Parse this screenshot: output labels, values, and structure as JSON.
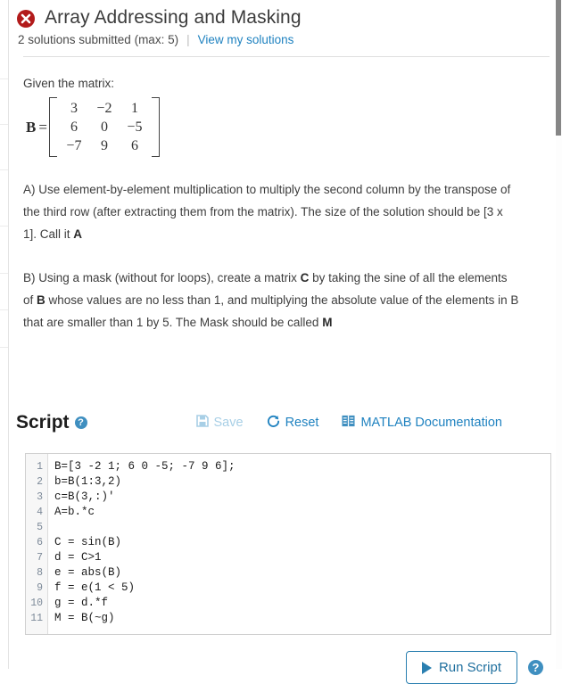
{
  "header": {
    "status_icon": "error-circle-x-icon",
    "title": "Array Addressing and Masking",
    "submissions_text": "2 solutions submitted (max: 5)",
    "separator": "|",
    "view_solutions_link": "View my solutions"
  },
  "problem": {
    "given_label": "Given the matrix:",
    "matrix": {
      "name": "B",
      "equals": "=",
      "rows": [
        [
          "3",
          "−2",
          "1"
        ],
        [
          "6",
          "0",
          "−5"
        ],
        [
          "−7",
          "9",
          "6"
        ]
      ]
    },
    "part_a_html": "A) Use element-by-element multiplication to multiply the second column by the transpose of the third row (after extracting them from the matrix). The size of the solution should be [3 x 1]. Call it <b>A</b>",
    "part_b_html": "B) Using a mask (without for loops), create a matrix <b>C</b> by taking the sine of all the elements of <b>B</b> whose values are no less than 1, and multiplying the absolute value of the elements in B that are smaller than 1 by 5.  The Mask should be called <b>M</b>"
  },
  "script": {
    "heading": "Script",
    "help_icon": "question-mark-badge-icon",
    "save_label": "Save",
    "save_icon": "floppy-disk-save-icon",
    "save_disabled": true,
    "reset_label": "Reset",
    "reset_icon": "circular-arrow-reset-icon",
    "docs_label": "MATLAB Documentation",
    "docs_icon": "book-documentation-icon"
  },
  "editor": {
    "line_numbers": [
      "1",
      "2",
      "3",
      "4",
      "5",
      "6",
      "7",
      "8",
      "9",
      "10",
      "11"
    ],
    "lines": [
      "B=[3 -2 1; 6 0 -5; -7 9 6];",
      "b=B(1:3,2)",
      "c=B(3,:)'",
      "A=b.*c",
      "",
      "C = sin(B)",
      "d = C>1",
      "e = abs(B)",
      "f = e(1 < 5)",
      "g = d.*f",
      "M = B(~g)"
    ]
  },
  "footer": {
    "run_label": "Run Script",
    "run_icon": "play-triangle-icon",
    "help_icon": "question-mark-badge-icon"
  },
  "colors": {
    "link_blue": "#1f82c0",
    "error_red": "#b21b1b",
    "disabled_blue": "#a8cfe6",
    "scrollbar": "#868686"
  }
}
